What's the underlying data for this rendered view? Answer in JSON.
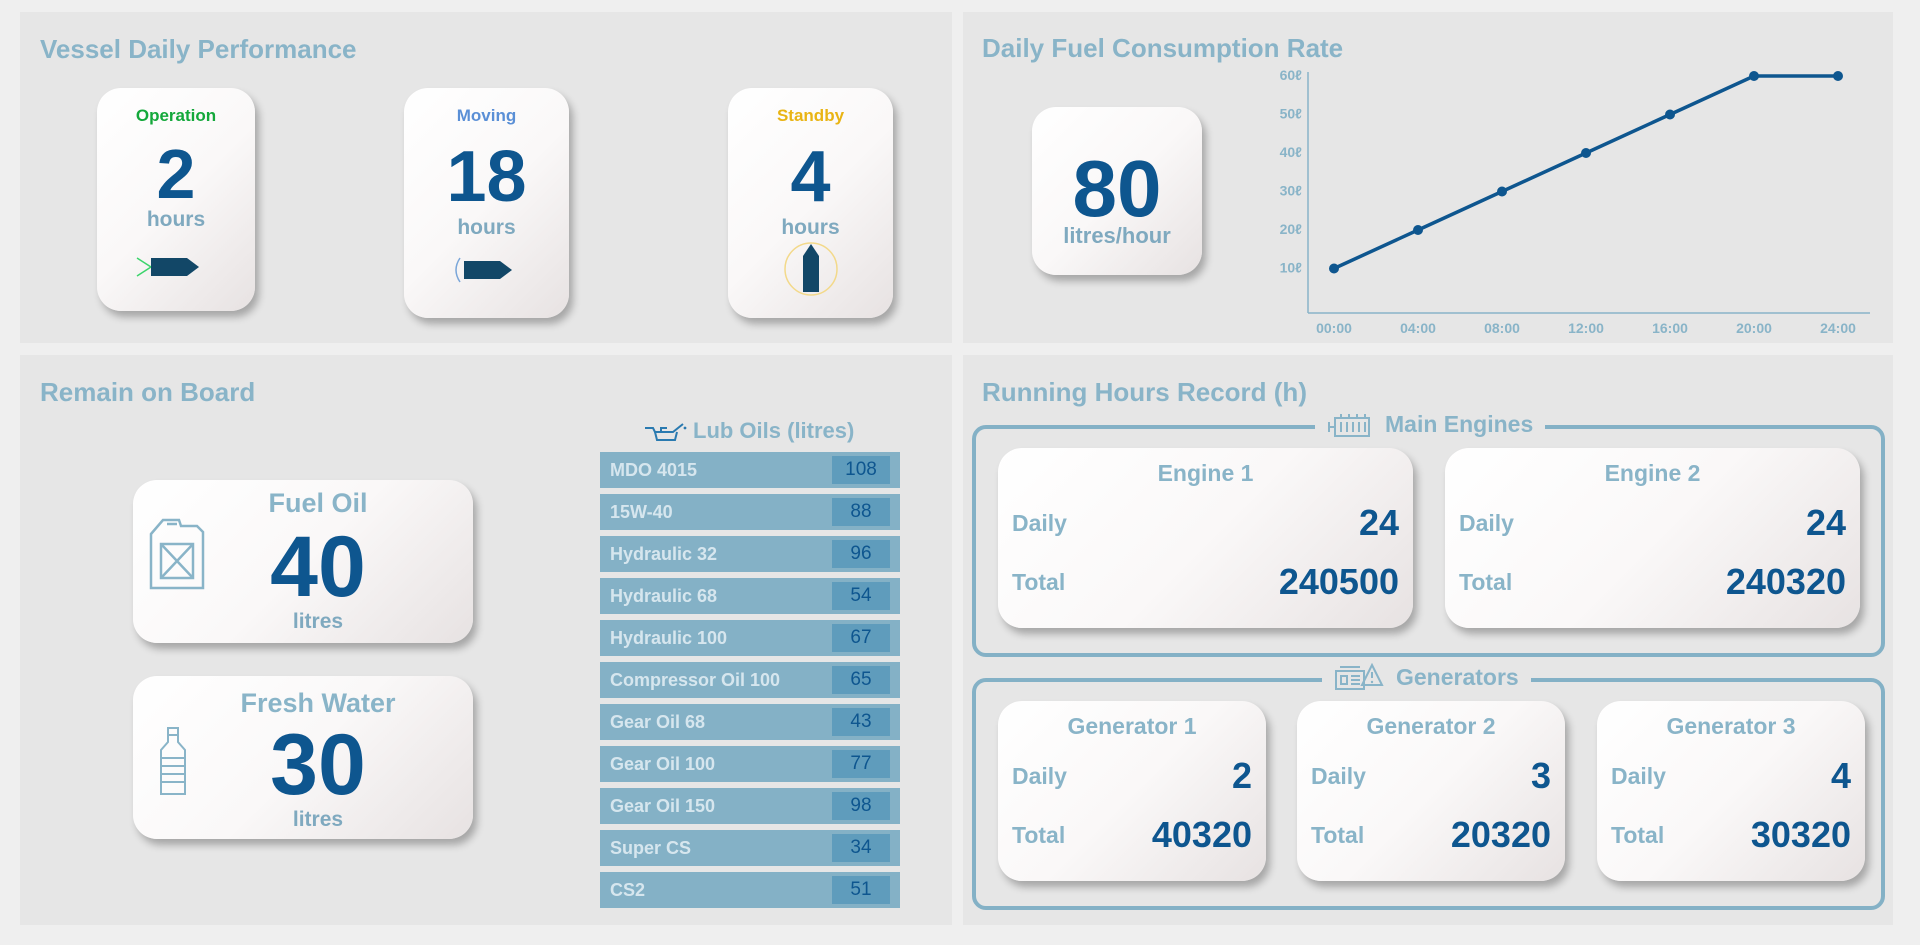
{
  "colors": {
    "accent": "#0e568f",
    "muted": "#89b4c8",
    "operation": "#14a83b",
    "moving": "#5a8fd6",
    "standby": "#e9b414",
    "oil_row": "#84b1c6",
    "oil_value": "#5f9cbc"
  },
  "performance": {
    "title": "Vessel Daily Performance",
    "operation": {
      "label": "Operation",
      "value": "2",
      "unit": "hours",
      "icon": "ship-operation-icon"
    },
    "moving": {
      "label": "Moving",
      "value": "18",
      "unit": "hours",
      "icon": "ship-moving-icon"
    },
    "standby": {
      "label": "Standby",
      "value": "4",
      "unit": "hours",
      "icon": "ship-standby-icon"
    }
  },
  "fuel_rate": {
    "title": "Daily Fuel Consumption Rate",
    "value": "80",
    "unit": "litres/hour"
  },
  "chart_data": {
    "type": "line",
    "title": "",
    "xlabel": "",
    "ylabel": "",
    "x": [
      "00:00",
      "04:00",
      "08:00",
      "12:00",
      "16:00",
      "20:00",
      "24:00"
    ],
    "series": [
      {
        "values": [
          10,
          20,
          30,
          40,
          50,
          60,
          60
        ]
      }
    ],
    "yticks": [
      "10ℓ",
      "20ℓ",
      "30ℓ",
      "40ℓ",
      "50ℓ",
      "60ℓ"
    ],
    "ylim": [
      0,
      60
    ],
    "grid": false
  },
  "rob": {
    "title": "Remain on Board",
    "fuel": {
      "label": "Fuel Oil",
      "value": "40",
      "unit": "litres",
      "icon": "jerrycan-icon"
    },
    "water": {
      "label": "Fresh Water",
      "value": "30",
      "unit": "litres",
      "icon": "water-bottle-icon"
    },
    "lub_title": "Lub Oils (litres)",
    "lub_oils": [
      {
        "name": "MDO 4015",
        "value": "108"
      },
      {
        "name": "15W-40",
        "value": "88"
      },
      {
        "name": "Hydraulic 32",
        "value": "96"
      },
      {
        "name": "Hydraulic 68",
        "value": "54"
      },
      {
        "name": "Hydraulic 100",
        "value": "67"
      },
      {
        "name": "Compressor Oil 100",
        "value": "65"
      },
      {
        "name": "Gear Oil 68",
        "value": "43"
      },
      {
        "name": "Gear Oil 100",
        "value": "77"
      },
      {
        "name": "Gear Oil 150",
        "value": "98"
      },
      {
        "name": "Super CS",
        "value": "34"
      },
      {
        "name": "CS2",
        "value": "51"
      }
    ]
  },
  "running": {
    "title": "Running Hours Record (h)",
    "main_label": "Main Engines",
    "gen_label": "Generators",
    "daily_label": "Daily",
    "total_label": "Total",
    "engines": [
      {
        "name": "Engine 1",
        "daily": "24",
        "total": "240500"
      },
      {
        "name": "Engine 2",
        "daily": "24",
        "total": "240320"
      }
    ],
    "generators": [
      {
        "name": "Generator 1",
        "daily": "2",
        "total": "40320"
      },
      {
        "name": "Generator 2",
        "daily": "3",
        "total": "20320"
      },
      {
        "name": "Generator 3",
        "daily": "4",
        "total": "30320"
      }
    ]
  }
}
